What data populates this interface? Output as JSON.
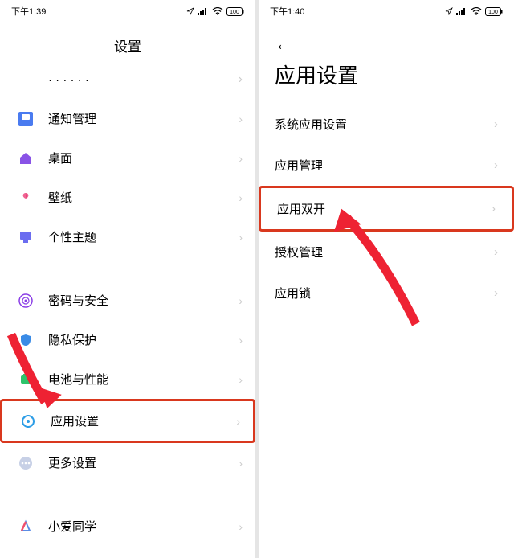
{
  "left_screen": {
    "status": {
      "time": "下午1:39",
      "battery": "100"
    },
    "title": "设置",
    "partial_top": "…",
    "items": [
      {
        "icon": "notification-icon",
        "color": "#4a7bf0",
        "label": "通知管理"
      },
      {
        "icon": "home-icon",
        "color": "#8953e6",
        "label": "桌面"
      },
      {
        "icon": "wallpaper-icon",
        "color": "#f06292",
        "label": "壁纸"
      },
      {
        "icon": "theme-icon",
        "color": "#6b6df0",
        "label": "个性主题"
      }
    ],
    "items2": [
      {
        "icon": "lock-icon",
        "color": "#8a3de6",
        "label": "密码与安全"
      },
      {
        "icon": "privacy-icon",
        "color": "#3a8be6",
        "label": "隐私保护"
      },
      {
        "icon": "battery-icon",
        "color": "#2dc46b",
        "label": "电池与性能"
      },
      {
        "icon": "app-settings-icon",
        "color": "#2d9de6",
        "label": "应用设置",
        "highlight": true
      },
      {
        "icon": "more-icon",
        "color": "#b8c1d9",
        "label": "更多设置"
      }
    ],
    "items3": [
      {
        "icon": "xiaoai-icon",
        "color": "#5a8de6",
        "label": "小爱同学"
      }
    ]
  },
  "right_screen": {
    "status": {
      "time": "下午1:40",
      "battery": "100"
    },
    "title": "应用设置",
    "items": [
      {
        "label": "系统应用设置"
      },
      {
        "label": "应用管理"
      },
      {
        "label": "应用双开",
        "highlight": true
      },
      {
        "label": "授权管理"
      },
      {
        "label": "应用锁"
      }
    ]
  }
}
